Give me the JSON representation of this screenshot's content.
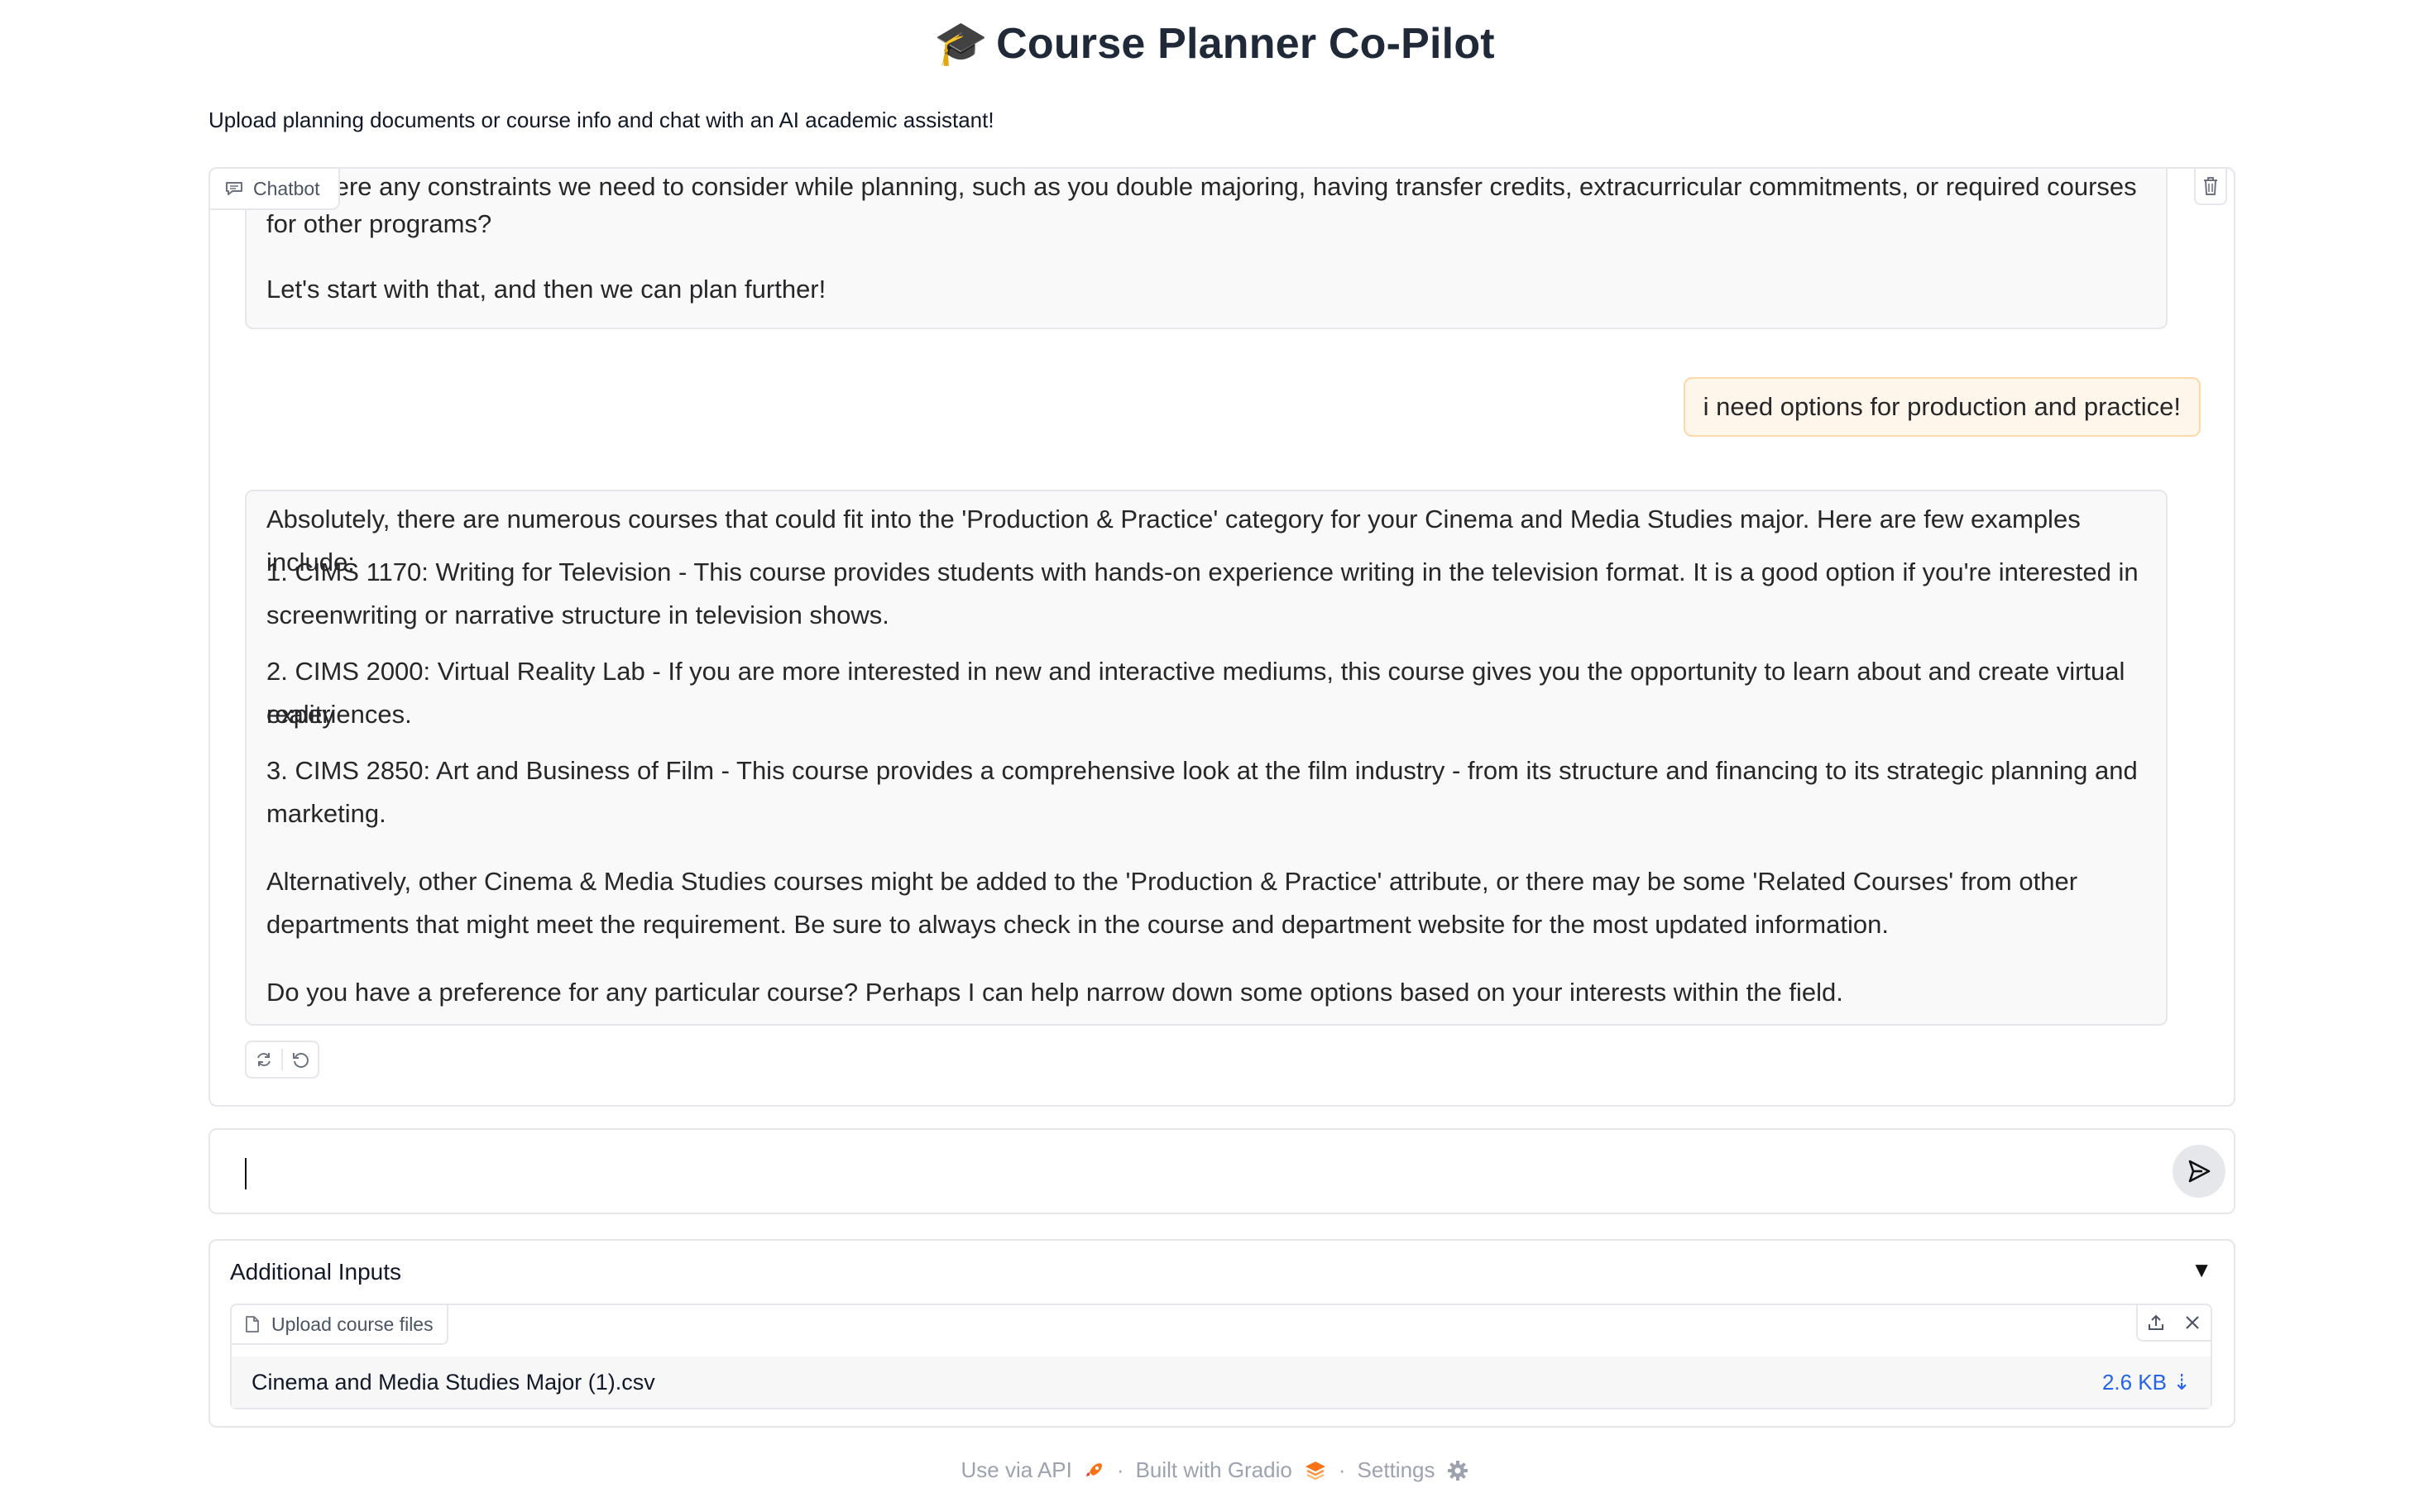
{
  "header": {
    "title_icon": "🎓",
    "title": "Course Planner Co-Pilot",
    "subtitle": "Upload planning documents or course info and chat with an AI academic assistant!"
  },
  "chatbot": {
    "label": "Chatbot",
    "messages": [
      {
        "role": "assistant",
        "lines": [
          "Are there any constraints we need to consider while planning, such as you double majoring, having transfer credits, extracurricular commitments, or required courses",
          "for other programs?",
          "Let's start with that, and then we can plan further!"
        ]
      },
      {
        "role": "user",
        "text": "i need options for production and practice!"
      },
      {
        "role": "assistant",
        "paragraphs": [
          "Absolutely, there are numerous courses that could fit into the 'Production & Practice' category for your Cinema and Media Studies major. Here are few examples include:",
          "1. CIMS 1170: Writing for Television - This course provides students with hands-on experience writing in the television format. It is a good option if you're interested in",
          "screenwriting or narrative structure in television shows.",
          "2. CIMS 2000: Virtual Reality Lab - If you are more interested in new and interactive mediums, this course gives you the opportunity to learn about and create virtual reality",
          "experiences.",
          "3. CIMS 2850: Art and Business of Film - This course provides a comprehensive look at the film industry - from its structure and financing to its strategic planning and",
          "marketing.",
          "Alternatively, other Cinema & Media Studies courses might be added to the 'Production & Practice' attribute, or there may be some 'Related Courses' from other",
          "departments that might meet the requirement. Be sure to always check in the course and department website for the most updated information.",
          "Do you have a preference for any particular course? Perhaps I can help narrow down some options based on your interests within the field."
        ]
      }
    ]
  },
  "input": {
    "value": "",
    "placeholder": ""
  },
  "additional_inputs": {
    "title": "Additional Inputs",
    "toggle_icon": "▼",
    "upload_label": "Upload course files",
    "file_name": "Cinema and Media Studies Major (1).csv",
    "file_size": "2.6 KB ⇣"
  },
  "footer": {
    "api": "Use via API",
    "sep1": "·",
    "gradio": "Built with Gradio",
    "sep2": "·",
    "settings": "Settings"
  },
  "colors": {
    "user_bubble_bg": "#fef6ea",
    "user_bubble_border": "#fbd9a8",
    "bot_bubble_bg": "#f9f9f9",
    "link": "#2563eb"
  }
}
